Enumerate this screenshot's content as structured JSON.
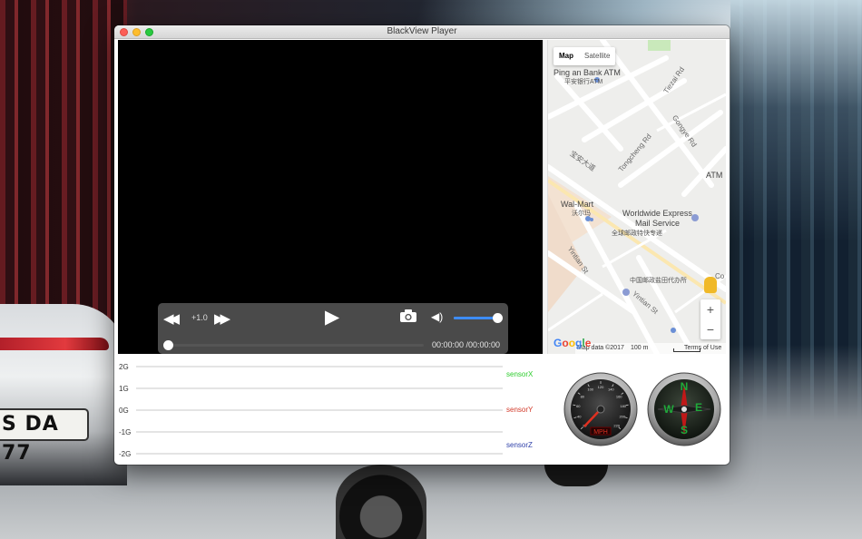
{
  "window": {
    "title": "BlackView Player"
  },
  "wallpaper": {
    "plate_text": "S DA 77"
  },
  "player": {
    "speed_label": "+1.0",
    "time_text": "00:00:00 /00:00:00",
    "progress": 0.0,
    "volume": 1.0
  },
  "map": {
    "tabs": [
      "Map",
      "Satellite"
    ],
    "active_tab": "Map",
    "labels": [
      {
        "text": "Ping an Bank ATM",
        "sub": "平安银行ATM"
      },
      {
        "text": "Wal-Mart",
        "sub": "沃尔玛"
      },
      {
        "text": "Worldwide Express",
        "sub": "Mail Service"
      },
      {
        "text": "全球邮政特快专递"
      },
      {
        "text": "中国邮政盐田代办所"
      },
      {
        "text": "ATM"
      }
    ],
    "roads": [
      "Tiezai Rd",
      "Gongye Rd",
      "Tongcheng Rd",
      "宝安大道",
      "Yintian St",
      "Yintian St",
      "Co"
    ],
    "logo": "Google",
    "footer_data": "Map data ©2017",
    "footer_scale": "100 m",
    "footer_terms": "Terms of Use",
    "zoom_in": "+",
    "zoom_out": "−"
  },
  "sensors": {
    "y_labels": [
      "2G",
      "1G",
      "0G",
      "-1G",
      "-2G"
    ],
    "series": [
      {
        "name": "sensorX",
        "color": "#2ecc2e"
      },
      {
        "name": "sensorY",
        "color": "#d23a2a"
      },
      {
        "name": "sensorZ",
        "color": "#2d3fa8"
      }
    ]
  },
  "chart_data": {
    "type": "line",
    "ylim": [
      -2,
      2
    ],
    "yticks": [
      "2G",
      "1G",
      "0G",
      "-1G",
      "-2G"
    ],
    "series": [
      {
        "name": "sensorX",
        "values": []
      },
      {
        "name": "sensorY",
        "values": []
      },
      {
        "name": "sensorZ",
        "values": []
      }
    ]
  },
  "speedometer": {
    "unit": "MPH",
    "value": 0,
    "ticks": [
      "20",
      "40",
      "60",
      "80",
      "100",
      "120",
      "140",
      "160",
      "180",
      "200",
      "220"
    ]
  },
  "compass": {
    "N": "N",
    "E": "E",
    "S": "S",
    "W": "W",
    "heading": 0
  },
  "colors": {
    "accent": "#3d8cf5",
    "video_bg": "#000000"
  }
}
